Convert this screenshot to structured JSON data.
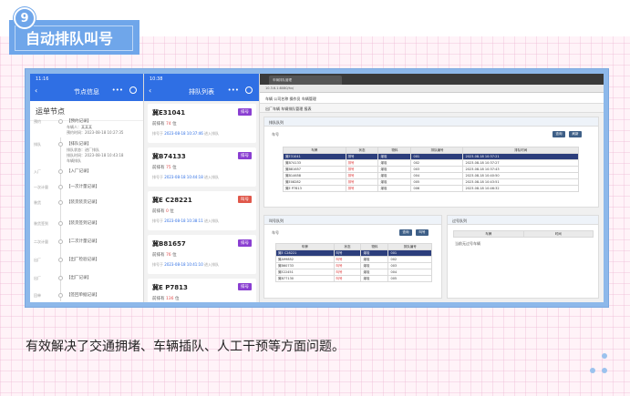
{
  "badge": "9",
  "title": "自动排队叫号",
  "description": "有效解决了交通拥堵、车辆插队、人工干预等方面问题。",
  "colors": {
    "accent": "#6fa6ea",
    "phone_header": "#2f6fe4",
    "grid_pink": "#fff3f8"
  },
  "phone1": {
    "status": "11:16",
    "title": "节点信息",
    "menu": "•••",
    "heading": "运单节点",
    "nodes": [
      {
        "label": "预约",
        "text": "【预约记录】"
      },
      {
        "label": "排队",
        "text": "【排队记录】"
      },
      {
        "label": "入厂",
        "text": "【入厂记录】"
      },
      {
        "label": "一次计量",
        "text": "【一次计量记录】"
      },
      {
        "label": "装货",
        "text": "【装货装货记录】"
      },
      {
        "label": "装货签到",
        "text": "【装货签到记录】"
      },
      {
        "label": "二次计量",
        "text": "【二次计量记录】"
      },
      {
        "label": "出厂",
        "text": "【出厂检验记录】"
      },
      {
        "label": "出厂",
        "text": "【出厂记录】"
      },
      {
        "label": "回单",
        "text": "【签回单据记录】"
      }
    ],
    "detail1": [
      "车辆人：某某某",
      "预约时间：2023-08-18 10:27:35"
    ],
    "detail2": [
      "排队状态：进厂排队",
      "排队时间：2023-08-18 10:43:18",
      "车辆排队"
    ]
  },
  "phone2": {
    "status": "10:38",
    "title": "排队列表",
    "menu": "•••",
    "cards": [
      {
        "plate": "冀E31041",
        "tag": "排号",
        "tag_color": "#8a3fd1",
        "pos": "74",
        "prefix": "前排有",
        "unit": "位",
        "time_label": "排号于",
        "time": "2023-08-18 10:37:46",
        "suffix": "进入排队"
      },
      {
        "plate": "冀B74133",
        "tag": "排号",
        "tag_color": "#8a3fd1",
        "pos": "75",
        "prefix": "前排有",
        "unit": "位",
        "time_label": "排号于",
        "time": "2023-08-18 10:44:18",
        "suffix": "进入排队"
      },
      {
        "plate": "冀E C28221",
        "tag": "叫号",
        "tag_color": "#e0584b",
        "pos": "0",
        "prefix": "前排有",
        "unit": "位",
        "time_label": "排号于",
        "time": "2023-08-18 10:38:11",
        "suffix": "进入排队"
      },
      {
        "plate": "冀B81657",
        "tag": "排号",
        "tag_color": "#8a3fd1",
        "pos": "76",
        "prefix": "前排有",
        "unit": "位",
        "time_label": "排号于",
        "time": "2023-08-18 10:41:10",
        "suffix": "进入排队"
      },
      {
        "plate": "冀E P7813",
        "tag": "排号",
        "tag_color": "#8a3fd1",
        "pos": "136",
        "prefix": "前排有",
        "unit": "位",
        "time_label": "排号于",
        "time": "2023-08-18 10:33:37",
        "suffix": "进入排队"
      }
    ]
  },
  "desktop": {
    "browser_tab": "车辆排队管理",
    "address": "10.3.6.1:8080/hv/",
    "app_bar": "车辆  公司名称  操作员  车辆管理",
    "app_tabs": "出厂车辆   车辆排队管理   报表",
    "panel1": {
      "title": "排队队列",
      "label": "车号",
      "btn1": "查询",
      "btn2": "刷新",
      "headers": [
        "车牌",
        "状态",
        "物料",
        "排队编号",
        "排队时间"
      ],
      "rows": [
        [
          "冀E31041",
          "排号",
          "煤炭",
          "001",
          "2023-08-18 10:37:21"
        ],
        [
          "冀B74133",
          "排号",
          "煤炭",
          "002",
          "2023-08-18 10:37:27"
        ],
        [
          "冀B81657",
          "排号",
          "煤炭",
          "003",
          "2023-08-18 10:37:43"
        ],
        [
          "冀B14658",
          "排号",
          "煤炭",
          "004",
          "2023-08-18 10:40:50"
        ],
        [
          "冀E08282",
          "排号",
          "煤炭",
          "005",
          "2023-08-18 10:43:51"
        ],
        [
          "冀E P7813",
          "排号",
          "煤炭",
          "006",
          "2023-08-18 10:46:32"
        ]
      ]
    },
    "panel2": {
      "title": "叫号队列",
      "label": "车号",
      "btn1": "查询",
      "btn2": "叫号",
      "headers": [
        "车牌",
        "状态",
        "物料",
        "排队编号"
      ],
      "rows": [
        [
          "冀E C28221",
          "叫号",
          "煤炭",
          "001"
        ],
        [
          "冀A99852",
          "叫号",
          "煤炭",
          "002"
        ],
        [
          "冀B60733",
          "叫号",
          "煤炭",
          "003"
        ],
        [
          "冀E22451",
          "叫号",
          "煤炭",
          "004"
        ],
        [
          "冀B77130",
          "叫号",
          "煤炭",
          "005"
        ]
      ]
    },
    "panel3": {
      "title": "过号队列",
      "headers": [
        "车牌",
        "时间"
      ],
      "note": "当前无过号车辆"
    }
  }
}
